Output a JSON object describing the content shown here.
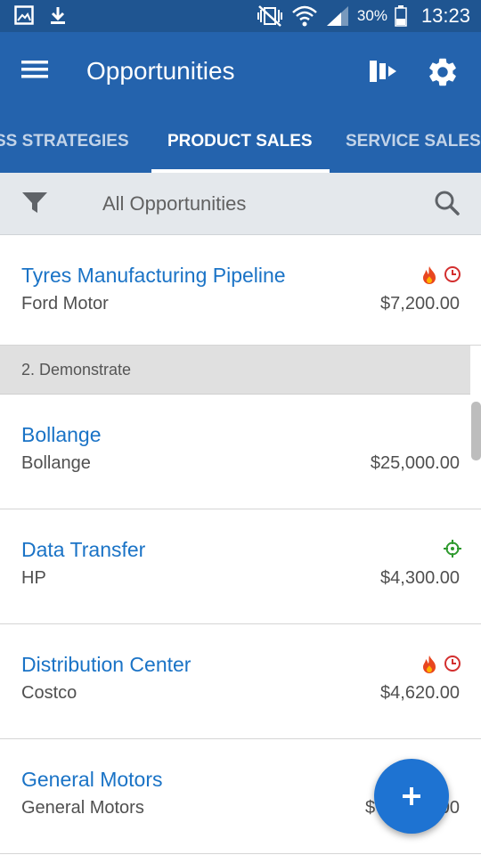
{
  "status_bar": {
    "battery_percent": "30%",
    "time": "13:23"
  },
  "app_bar": {
    "title": "Opportunities",
    "icons": [
      "menu-icon",
      "pipeline-view-icon",
      "gear-icon"
    ]
  },
  "tabs": [
    {
      "label": "SS STRATEGIES",
      "active": false
    },
    {
      "label": "PRODUCT SALES",
      "active": true
    },
    {
      "label": "SERVICE SALES",
      "active": false
    }
  ],
  "filter": {
    "label": "All Opportunities"
  },
  "rows_top": [
    {
      "title": "Tyres Manufacturing Pipeline",
      "subtitle": "Ford Motor",
      "amount": "$7,200.00",
      "icons": [
        "fire-icon",
        "clock-icon"
      ]
    }
  ],
  "section": {
    "label": "2. Demonstrate"
  },
  "rows": [
    {
      "title": "Bollange",
      "subtitle": "Bollange",
      "amount": "$25,000.00",
      "icons": []
    },
    {
      "title": "Data Transfer",
      "subtitle": "HP",
      "amount": "$4,300.00",
      "icons": [
        "target-icon"
      ]
    },
    {
      "title": "Distribution Center",
      "subtitle": "Costco",
      "amount": "$4,620.00",
      "icons": [
        "fire-icon",
        "clock-icon"
      ]
    },
    {
      "title": "General Motors",
      "subtitle": "General Motors",
      "amount": "$",
      "amount_tail": "00",
      "icons": []
    }
  ],
  "colors": {
    "status_bar": "#1f5591",
    "app_bar": "#2463ad",
    "link": "#1a73c6",
    "fab": "#1e73d2",
    "fire": "#e8461f",
    "clock": "#d32f2f",
    "target": "#2e9a2e"
  },
  "fab": {
    "icon": "plus-icon"
  }
}
